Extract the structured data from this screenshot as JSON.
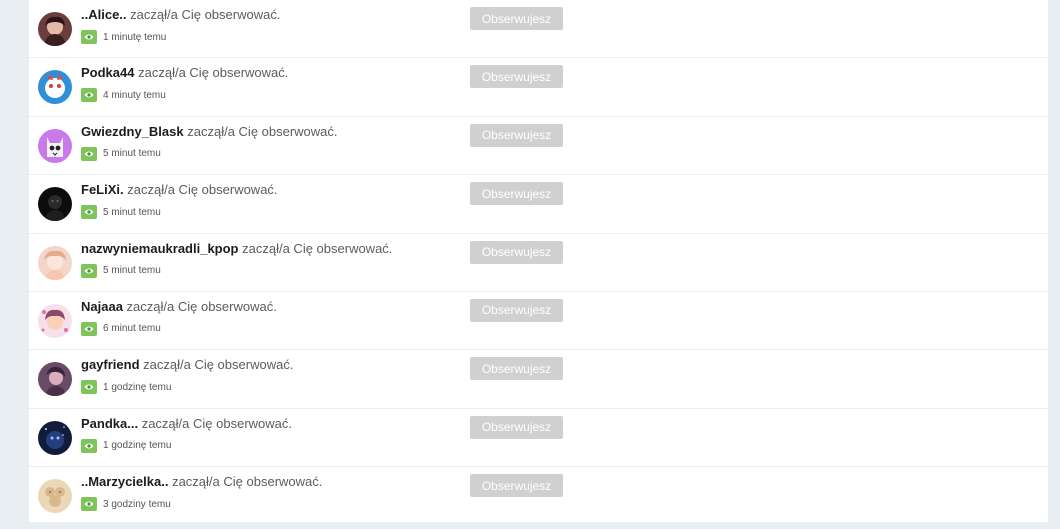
{
  "notifications": {
    "items": [
      {
        "username": "..Alice..",
        "action": "zaczął/a Cię obserwować.",
        "time": "1 minutę temu",
        "button_label": "Obserwujesz"
      },
      {
        "username": "Podka44",
        "action": "zaczął/a Cię obserwować.",
        "time": "4 minuty temu",
        "button_label": "Obserwujesz"
      },
      {
        "username": "Gwiezdny_Blask",
        "action": "zaczął/a Cię obserwować.",
        "time": "5 minut temu",
        "button_label": "Obserwujesz"
      },
      {
        "username": "FeLiXi.",
        "action": "zaczął/a Cię obserwować.",
        "time": "5 minut temu",
        "button_label": "Obserwujesz"
      },
      {
        "username": "nazwyniemaukradli_kpop",
        "action": "zaczął/a Cię obserwować.",
        "time": "5 minut temu",
        "button_label": "Obserwujesz"
      },
      {
        "username": "Najaaa",
        "action": "zaczął/a Cię obserwować.",
        "time": "6 minut temu",
        "button_label": "Obserwujesz"
      },
      {
        "username": "gayfriend",
        "action": "zaczął/a Cię obserwować.",
        "time": "1 godzinę temu",
        "button_label": "Obserwujesz"
      },
      {
        "username": "Pandka...",
        "action": "zaczął/a Cię obserwować.",
        "time": "1 godzinę temu",
        "button_label": "Obserwujesz"
      },
      {
        "username": "..Marzycielka..",
        "action": "zaczął/a Cię obserwować.",
        "time": "3 godziny temu",
        "button_label": "Obserwujesz"
      }
    ]
  },
  "colors": {
    "page_background": "#e9eef2",
    "panel_background": "#ffffff",
    "button_background": "#d0d0d0",
    "eye_badge": "#7dc55a"
  },
  "icons": {
    "time_badge": "eye-icon"
  }
}
